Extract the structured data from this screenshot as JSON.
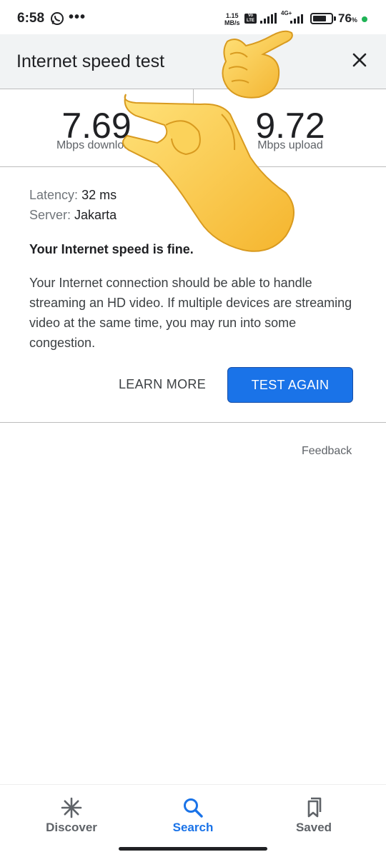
{
  "status_bar": {
    "time": "6:58",
    "more": "•••",
    "net_speed_value": "1.15",
    "net_speed_unit": "MB/s",
    "volte": "Vo LTE",
    "network": "4G+",
    "battery": "76",
    "battery_unit": "%",
    "battery_level": 0.76
  },
  "header": {
    "title": "Internet speed test"
  },
  "results": {
    "download_value": "7.69",
    "download_label": "Mbps download",
    "upload_value": "9.72",
    "upload_label": "Mbps upload"
  },
  "details": {
    "latency_key": "Latency:",
    "latency_value": "32 ms",
    "server_key": "Server:",
    "server_value": "Jakarta",
    "verdict": "Your Internet speed is fine.",
    "description": "Your Internet connection should be able to handle streaming an HD video. If multiple devices are streaming video at the same time, you may run into some congestion."
  },
  "actions": {
    "learn_more": "LEARN MORE",
    "test_again": "TEST AGAIN"
  },
  "feedback": "Feedback",
  "bottom_nav": {
    "items": [
      {
        "label": "Discover",
        "icon": "asterisk-icon",
        "active": false
      },
      {
        "label": "Search",
        "icon": "search-icon",
        "active": true
      },
      {
        "label": "Saved",
        "icon": "bookmarks-icon",
        "active": false
      }
    ]
  },
  "overlays": [
    "pinching-hand-emoji",
    "pointing-hand-emoji"
  ],
  "colors": {
    "accent": "#1a73e8",
    "header_bg": "#f1f3f4",
    "status_dot": "#1fb356"
  }
}
